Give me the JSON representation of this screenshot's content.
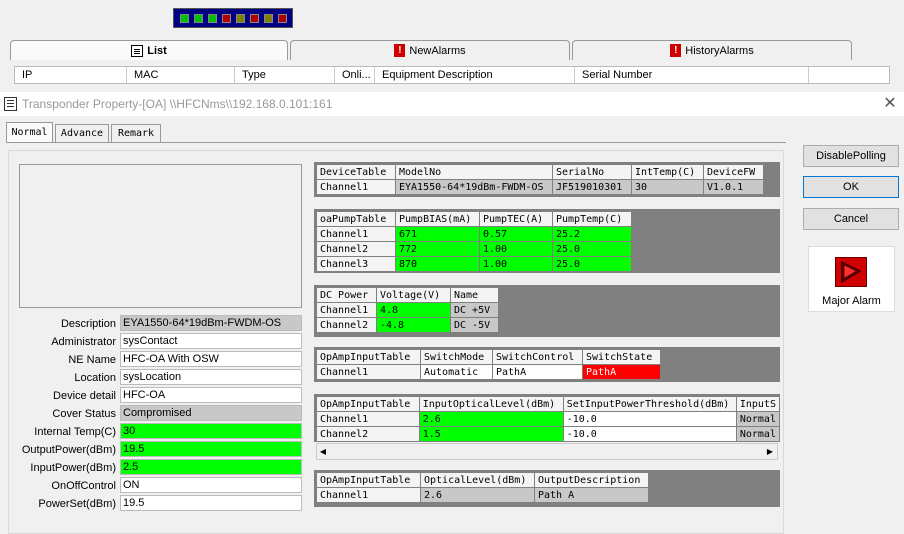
{
  "leds": [
    "#00c000",
    "#00c000",
    "#00c000",
    "#b00000",
    "#808000",
    "#b00000",
    "#808000",
    "#b00000"
  ],
  "main_tabs": [
    {
      "label": "List",
      "icon": "list-icon"
    },
    {
      "label": "NewAlarms",
      "icon": "alarm-icon"
    },
    {
      "label": "HistoryAlarms",
      "icon": "alarm-icon"
    }
  ],
  "list_columns": [
    "IP",
    "MAC",
    "Type",
    "Onli...",
    "Equipment Description",
    "Serial Number"
  ],
  "dialog": {
    "title": "Transponder Property-[OA] \\\\HFCNms\\\\192.168.0.101:161",
    "close": "✕",
    "tabs": [
      "Normal",
      "Advance",
      "Remark"
    ]
  },
  "properties": [
    {
      "label": "Description",
      "value": "EYA1550-64*19dBm-FWDM-OS",
      "style": "gray"
    },
    {
      "label": "Administrator",
      "value": "sysContact",
      "style": "white"
    },
    {
      "label": "NE Name",
      "value": "HFC-OA With OSW",
      "style": "white"
    },
    {
      "label": "Location",
      "value": "sysLocation",
      "style": "white"
    },
    {
      "label": "Device detail",
      "value": "HFC-OA",
      "style": "white"
    },
    {
      "label": "Cover Status",
      "value": "Compromised",
      "style": "gray"
    },
    {
      "label": "Internal Temp(C)",
      "value": "30",
      "style": "green"
    },
    {
      "label": "OutputPower(dBm)",
      "value": "19.5",
      "style": "green"
    },
    {
      "label": "InputPower(dBm)",
      "value": "2.5",
      "style": "green"
    },
    {
      "label": "OnOffControl",
      "value": "ON",
      "style": "white"
    },
    {
      "label": "PowerSet(dBm)",
      "value": "19.5",
      "style": "white"
    }
  ],
  "device_table": {
    "headers": [
      "DeviceTable",
      "ModelNo",
      "SerialNo",
      "IntTemp(C)",
      "DeviceFW"
    ],
    "rows": [
      [
        "Channel1",
        "EYA1550-64*19dBm-FWDM-OS",
        "JF519010301",
        "30",
        "V1.0.1"
      ]
    ]
  },
  "pump_table": {
    "headers": [
      "oaPumpTable",
      "PumpBIAS(mA)",
      "PumpTEC(A)",
      "PumpTemp(C)"
    ],
    "rows": [
      [
        "Channel1",
        "671",
        "0.57",
        "25.2"
      ],
      [
        "Channel2",
        "772",
        "1.00",
        "25.0"
      ],
      [
        "Channel3",
        "870",
        "1.00",
        "25.0"
      ]
    ]
  },
  "power_table": {
    "headers": [
      "DC Power",
      "Voltage(V)",
      "Name"
    ],
    "rows": [
      [
        "Channel1",
        "4.8",
        "DC +5V"
      ],
      [
        "Channel2",
        "-4.8",
        "DC -5V"
      ]
    ]
  },
  "switch_table": {
    "headers": [
      "OpAmpInputTable",
      "SwitchMode",
      "SwitchControl",
      "SwitchState"
    ],
    "rows": [
      [
        "Channel1",
        "Automatic",
        "PathA",
        "PathA"
      ]
    ]
  },
  "input_table": {
    "headers": [
      "OpAmpInputTable",
      "InputOpticalLevel(dBm)",
      "SetInputPowerThreshold(dBm)",
      "InputS"
    ],
    "rows": [
      [
        "Channel1",
        "2.6",
        "-10.0",
        "Normal"
      ],
      [
        "Channel2",
        "1.5",
        "-10.0",
        "Normal"
      ]
    ]
  },
  "output_table": {
    "headers": [
      "OpAmpInputTable",
      "OpticalLevel(dBm)",
      "OutputDescription"
    ],
    "rows": [
      [
        "Channel1",
        "2.6",
        "Path A"
      ]
    ]
  },
  "buttons": {
    "disable_polling": "DisablePolling",
    "ok": "OK",
    "cancel": "Cancel"
  },
  "alarm": {
    "label": "Major Alarm"
  },
  "scroll": {
    "left": "◀",
    "right": "▶"
  }
}
